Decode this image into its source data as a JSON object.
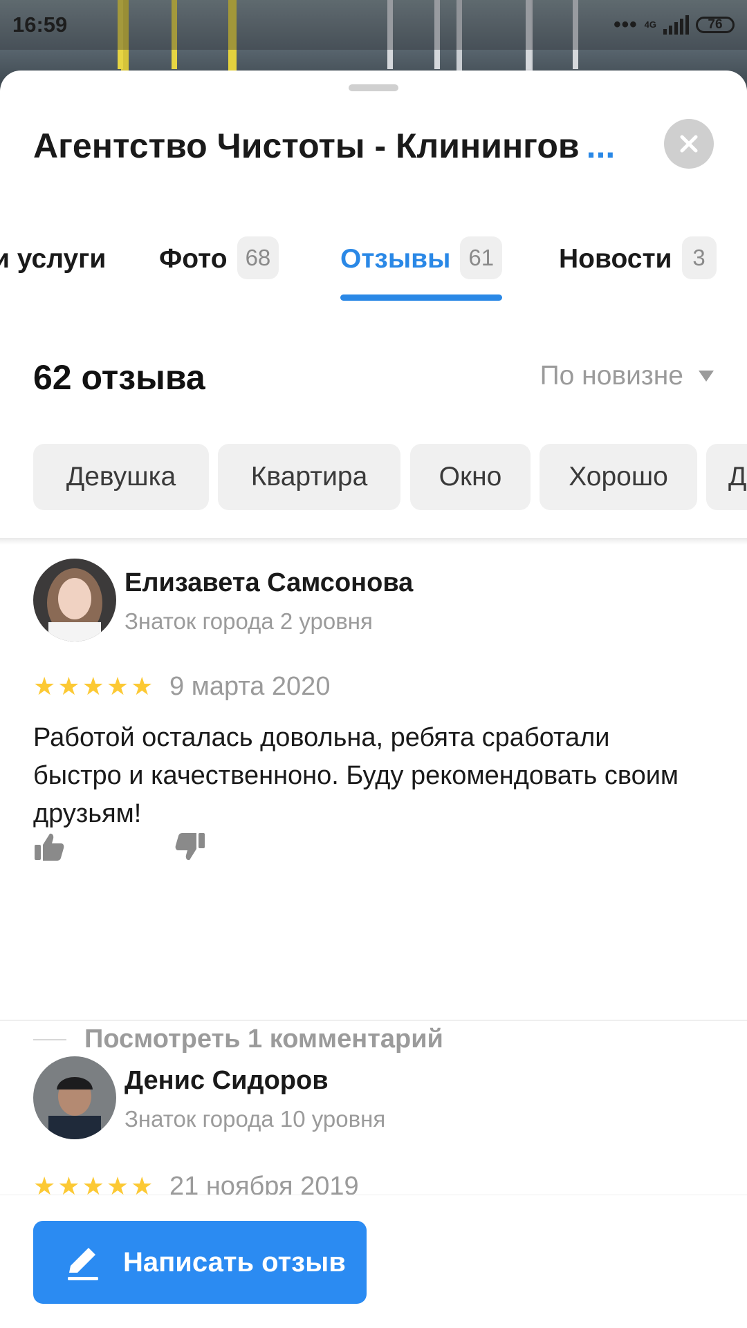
{
  "status_bar": {
    "time": "16:59",
    "network": "4G",
    "battery": "76"
  },
  "header": {
    "title": "Агентство Чистоты - Клинингов",
    "title_more": "..."
  },
  "tabs": [
    {
      "label": "и услуги",
      "badge": "",
      "active": false
    },
    {
      "label": "Фото",
      "badge": "68",
      "active": false
    },
    {
      "label": "Отзывы",
      "badge": "61",
      "active": true
    },
    {
      "label": "Новости",
      "badge": "3",
      "active": false
    }
  ],
  "reviews_header": {
    "count_label": "62 отзыва",
    "sort_label": "По новизне"
  },
  "chips": [
    "Девушка",
    "Квартира",
    "Окно",
    "Хорошо",
    "Д"
  ],
  "reviews": [
    {
      "author": "Елизавета Самсонова",
      "level": "Знаток города 2 уровня",
      "rating": 5,
      "date": "9 марта 2020",
      "text": "Работой осталась довольна, ребята сработали быстро и качественноно. Буду рекомендовать своим друзьям!",
      "comments_label": "Посмотреть 1 комментарий"
    },
    {
      "author": "Денис Сидоров",
      "level": "Знаток города 10 уровня",
      "rating": 5,
      "date": "21 ноября 2019"
    }
  ],
  "actions": {
    "write_review_label": "Написать отзыв"
  },
  "colors": {
    "accent": "#2a88e6",
    "star": "#fcc934",
    "muted_text": "#9b9b9b",
    "chip_bg": "#f0f0f0"
  }
}
